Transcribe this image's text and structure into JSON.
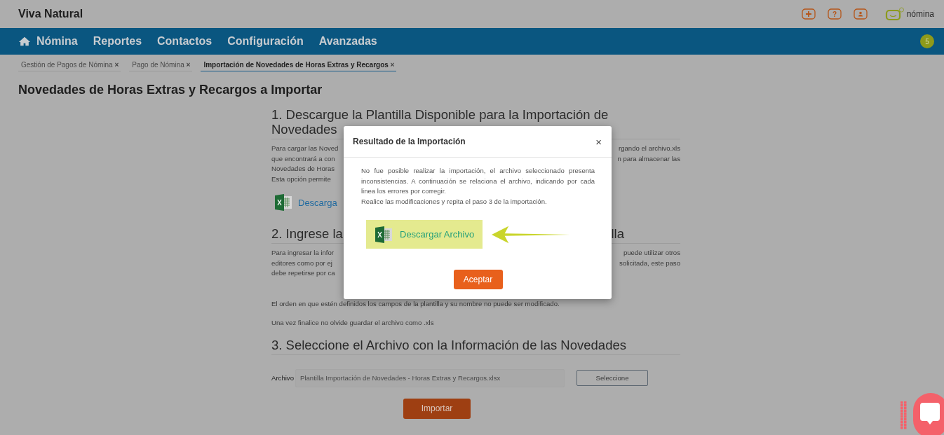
{
  "header": {
    "company": "Viva Natural",
    "actions": [
      {
        "kind": "plus"
      },
      {
        "kind": "help",
        "glyph": "?"
      },
      {
        "kind": "user"
      }
    ],
    "product": "nómina"
  },
  "nav": {
    "items": [
      {
        "label": "Nómina",
        "kind": "home"
      },
      {
        "label": "Reportes"
      },
      {
        "label": "Contactos"
      },
      {
        "label": "Configuración"
      },
      {
        "label": "Avanzadas"
      }
    ],
    "badge": "5"
  },
  "tabs": [
    {
      "label": "Gestión de Pagos de Nómina",
      "close": "×",
      "selected": false
    },
    {
      "label": "Pago de Nómina",
      "close": "×",
      "selected": false
    },
    {
      "label": "Importación de Novedades de Horas Extras y Recargos",
      "close": "×",
      "selected": true
    }
  ],
  "page_title": "Novedades de Horas Extras y Recargos a Importar",
  "sections": [
    {
      "heading": [
        {
          "text": "1. Descargue la Plantilla Disponible para la Importación de"
        },
        {
          "text": "Novedades"
        }
      ],
      "paragraphs": [
        [
          {
            "text": "Para cargar las Noved",
            "right": "rgando el archivo.xls"
          },
          {
            "text": "que encontrará a con",
            "right": "n para almacenar las"
          },
          {
            "text": "Novedades de Horas"
          },
          {
            "text": "Esta opción permite"
          }
        ]
      ],
      "link": "Descarga"
    },
    {
      "heading": [
        {
          "text": "2. Ingrese la",
          "right": "lla"
        }
      ],
      "paragraphs": [
        [
          {
            "text": "Para ingresar la infor",
            "right": "puede utilizar otros"
          },
          {
            "text": "editores como por ej",
            "right": "solicitada, este paso"
          },
          {
            "text": "debe repetirse por ca"
          }
        ],
        [
          {
            "text": "El orden en que estén definidos los campos de la plantilla y su nombre no puede ser modificado."
          }
        ],
        [
          {
            "text": "Una vez finalice no olvide guardar el archivo como .xls"
          }
        ]
      ]
    },
    {
      "heading": [
        {
          "text": "3. Seleccione el Archivo con la Información de las Novedades"
        }
      ],
      "file": {
        "label": "Archivo",
        "value": "Plantilla Importación de Novedades - Horas Extras y Recargos.xlsx",
        "button": "Seleccione"
      }
    }
  ],
  "import_button": "Importar",
  "dialog": {
    "title": "Resultado de la Importación",
    "close": "×",
    "message": "No fue posible realizar la importación, el archivo seleccionado presenta inconsistencias. A continuación se relaciona el archivo, indicando por cada linea los errores por corregir.",
    "note": "Realice las modificaciones y repita el paso 3 de la importación.",
    "download": "Descargar Archivo",
    "ok": "Aceptar"
  }
}
